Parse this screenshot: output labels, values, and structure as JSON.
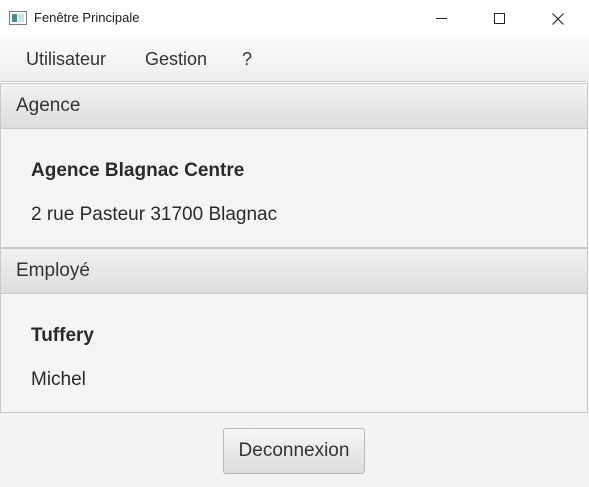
{
  "window": {
    "title": "Fenêtre Principale"
  },
  "menu": {
    "items": [
      "Utilisateur",
      "Gestion",
      "?"
    ]
  },
  "agence": {
    "header": "Agence",
    "name": "Agence Blagnac Centre",
    "address": "2 rue Pasteur 31700 Blagnac"
  },
  "employe": {
    "header": "Employé",
    "lastname": "Tuffery",
    "firstname": "Michel"
  },
  "actions": {
    "logout_label": "Deconnexion"
  },
  "icons": {
    "app": "window-app-icon",
    "minimize": "minimize-icon",
    "maximize": "maximize-icon",
    "close": "close-icon"
  }
}
